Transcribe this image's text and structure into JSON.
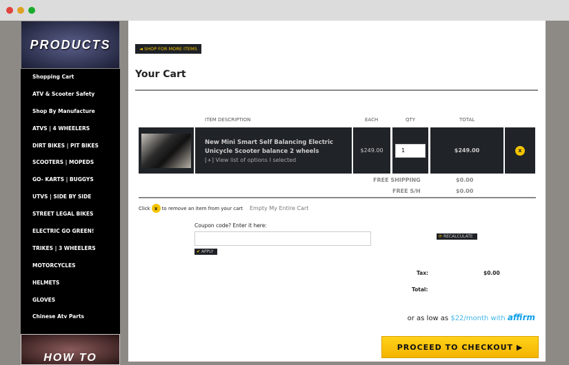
{
  "window": {
    "colors": {
      "close": "#e0443e",
      "min": "#dea123",
      "max": "#1aab29"
    }
  },
  "sidebar": {
    "banner": "PRODUCTS",
    "banner2": "HOW TO",
    "items": [
      "Shopping Cart",
      "ATV & Scooter Safety",
      "Shop By Manufacture",
      "ATVS | 4 WHEELERS",
      "DIRT BIKES | PIT BIKES",
      "SCOOTERS | MOPEDS",
      "GO- KARTS | BUGGYS",
      "UTVS | SIDE BY SIDE",
      "STREET LEGAL BIKES",
      "ELECTRIC GO GREEN!",
      "TRIKES | 3 WHEELERS",
      "MOTORCYCLES",
      "HELMETS",
      "GLOVES",
      "Chinese Atv Parts"
    ]
  },
  "main": {
    "shop_more": "◄ SHOP FOR MORE ITEMS",
    "title": "Your Cart",
    "headers": {
      "desc": "ITEM  DESCRIPTION",
      "each": "EACH",
      "qty": "QTY",
      "total": "TOTAL"
    },
    "item": {
      "name": "New Mini Smart Self Balancing Electric Unicycle Scooter balance 2 wheels",
      "options": "[+] View list of options I selected",
      "each": "$249.00",
      "qty": "1",
      "total": "$249.00",
      "remove": "x"
    },
    "shipping_label": "FREE SHIPPING",
    "shipping": "$0.00",
    "sh_label": "FREE S/H",
    "sh": "$0.00",
    "click": "Click",
    "remove_hint": "to remove an item from your cart",
    "empty": "Empty My Entire Cart",
    "coupon_label": "Coupon code? Enter it here:",
    "coupon_value": "",
    "apply": "APPLY",
    "recalc": "RECALCULATE",
    "tax_label": "Tax:",
    "tax": "$0.00",
    "total_label": "Total:",
    "affirm_pre": "or as low as",
    "affirm_amount": "$22/month with",
    "affirm_logo": "affirm",
    "checkout": "PROCEED TO CHECKOUT ▶"
  }
}
